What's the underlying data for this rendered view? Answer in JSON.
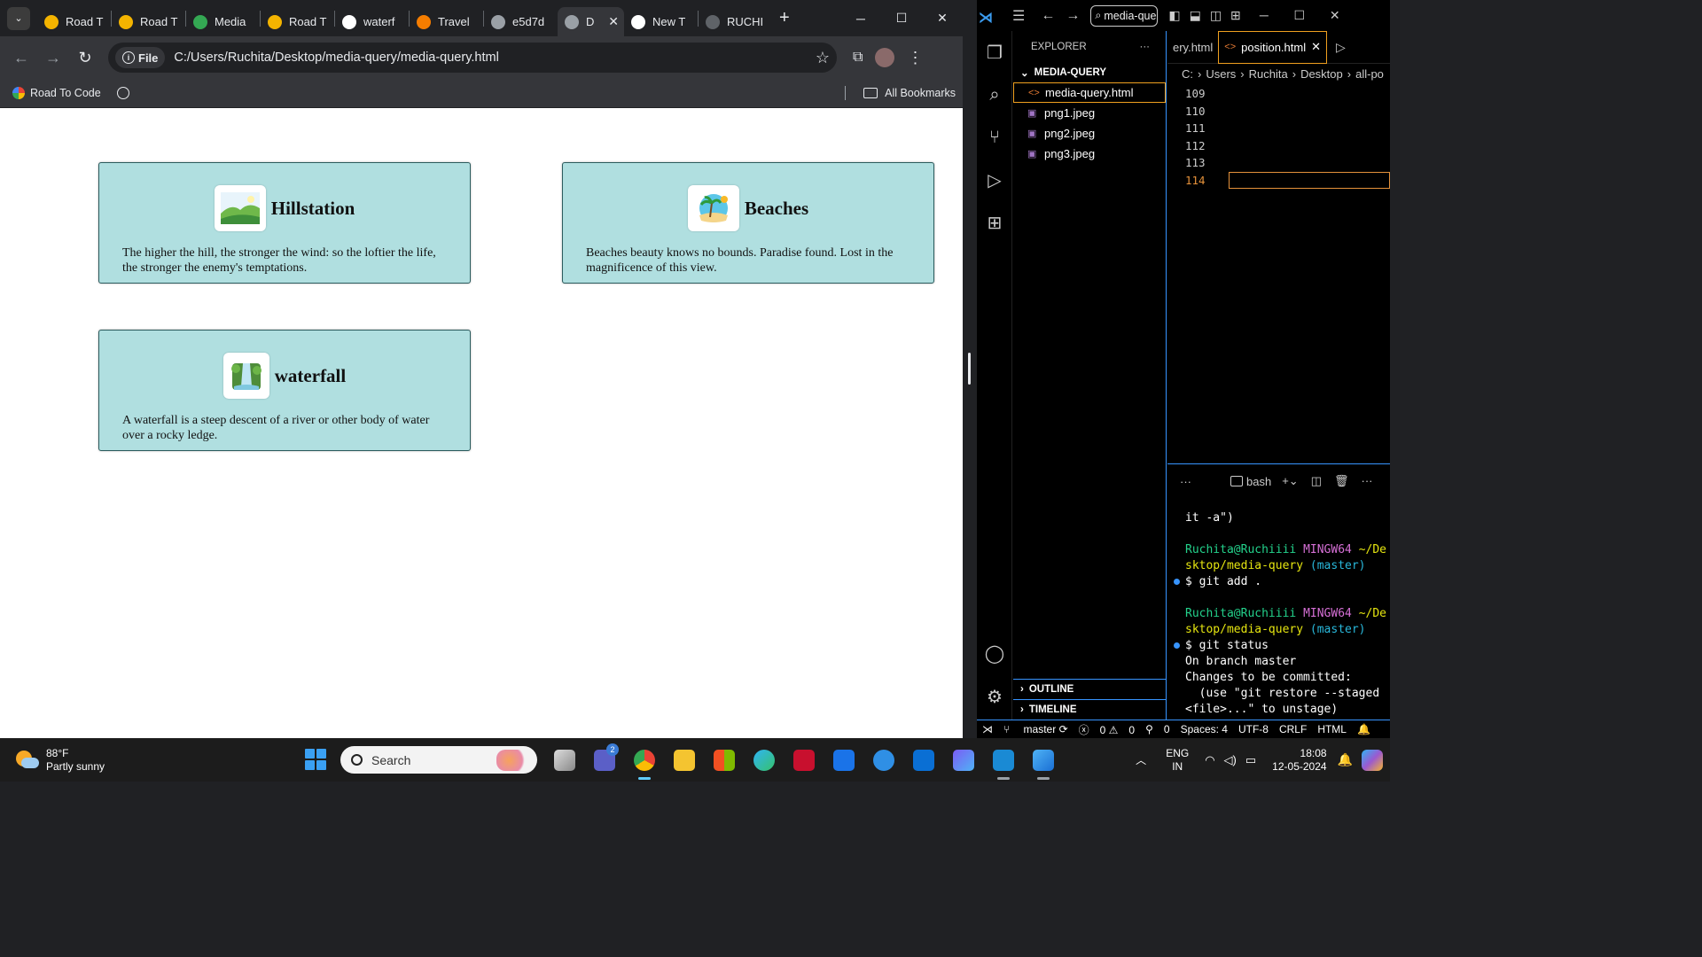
{
  "browser": {
    "tabs": [
      {
        "label": "Road T",
        "color": "#f4b400"
      },
      {
        "label": "Road T",
        "color": "#f4b400"
      },
      {
        "label": "Media",
        "color": "#34a853"
      },
      {
        "label": "Road T",
        "color": "#f4b400"
      },
      {
        "label": "waterf",
        "color": "#ffffff"
      },
      {
        "label": "Travel",
        "color": "#f57d00"
      },
      {
        "label": "e5d7d",
        "color": "#9aa0a6"
      },
      {
        "label": "D",
        "color": "#9aa0a6",
        "active": true
      },
      {
        "label": "New T",
        "color": "#ffffff"
      },
      {
        "label": "RUCHI",
        "color": "#5f6368"
      }
    ],
    "window_controls": {
      "minimize": "─",
      "maximize": "☐",
      "close": "✕"
    },
    "site_chip": "File",
    "url": "C:/Users/Ruchita/Desktop/media-query/media-query.html",
    "bookmarks": {
      "item": "Road To Code",
      "all": "All Bookmarks"
    }
  },
  "page": {
    "cards": [
      {
        "title": "Hillstation",
        "text": "The higher the hill, the stronger the wind: so the loftier the life, the stronger the enemy's temptations.",
        "icon": "hill-icon"
      },
      {
        "title": "Beaches",
        "text": "Beaches beauty knows no bounds. Paradise found. Lost in the magnificence of this view.",
        "icon": "beach-icon"
      },
      {
        "title": "waterfall",
        "text": "A waterfall is a steep descent of a river or other body of water over a rocky ledge.",
        "icon": "waterfall-icon"
      }
    ],
    "card_bg": "#b0dfe0"
  },
  "vscode": {
    "search": "media-que",
    "explorer": {
      "title": "EXPLORER",
      "folder": "MEDIA-QUERY",
      "files": [
        "media-query.html",
        "png1.jpeg",
        "png2.jpeg",
        "png3.jpeg"
      ],
      "outline": "OUTLINE",
      "timeline": "TIMELINE"
    },
    "editor": {
      "prev_tab": "ery.html",
      "active_tab": "position.html",
      "breadcrumbs": [
        "C:",
        "Users",
        "Ruchita",
        "Desktop",
        "all-po"
      ],
      "line_numbers": [
        "109",
        "110",
        "111",
        "112",
        "113",
        "114"
      ]
    },
    "terminal": {
      "shell": "bash",
      "line1": "it -a\")",
      "user": "Ruchita@Ruchiiii",
      "host": "MINGW64",
      "path1": "~/De",
      "path2": "sktop/media-query",
      "branch": "(master)",
      "cmd1": "$ git add .",
      "cmd2": "$ git status",
      "out1": "On branch master",
      "out2": "Changes to be committed:",
      "out3": "  (use \"git restore --staged",
      "out4": "<file>...\" to unstage)"
    },
    "status": {
      "branch": "master",
      "errors": "0",
      "warnings": "0",
      "ports": "0",
      "spaces": "Spaces: 4",
      "encoding": "UTF-8",
      "eol": "CRLF",
      "language": "HTML"
    }
  },
  "taskbar": {
    "temp": "88°F",
    "condition": "Partly sunny",
    "search": "Search",
    "teams_badge": "2",
    "lang1": "ENG",
    "lang2": "IN",
    "time": "18:08",
    "date": "12-05-2024"
  }
}
